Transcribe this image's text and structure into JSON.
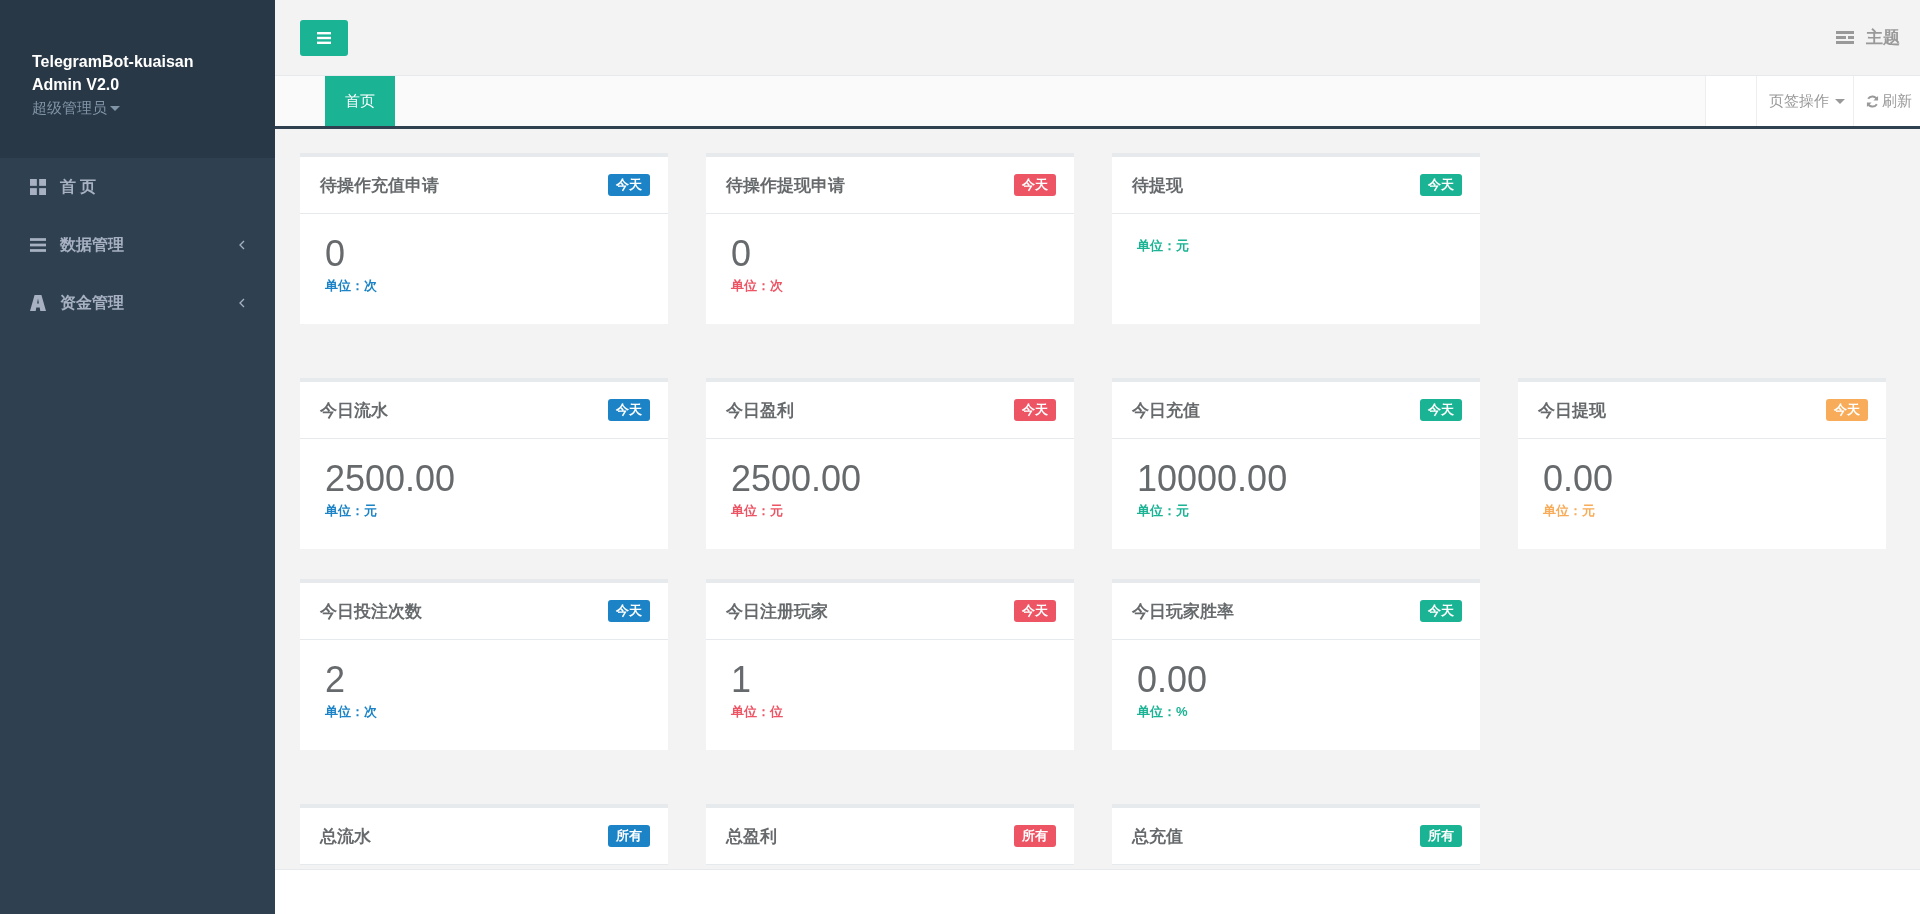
{
  "sidebar": {
    "brand": [
      "TelegramBot-kuaisan",
      "Admin V2.0"
    ],
    "role": "超级管理员",
    "items": [
      {
        "kind": "grid",
        "label": "首 页",
        "expandable": false
      },
      {
        "kind": "list",
        "label": "数据管理",
        "expandable": true
      },
      {
        "kind": "letter",
        "label": "资金管理",
        "expandable": true
      }
    ]
  },
  "topbar": {
    "theme": "主题"
  },
  "tabs": [
    {
      "label": "首页",
      "selected": true
    }
  ],
  "tab_actions": {
    "menu": "页签操作",
    "refresh": "刷新"
  },
  "groups": [
    {
      "cards": [
        {
          "title": "待操作充值申请",
          "badge": "今天",
          "color": "#1c84c6",
          "value": "0",
          "unit": "单位：次"
        },
        {
          "title": "待操作提现申请",
          "badge": "今天",
          "color": "#ed5565",
          "value": "0",
          "unit": "单位：次"
        },
        {
          "title": "待提现",
          "badge": "今天",
          "color": "#1ab394",
          "unit": "单位：元"
        }
      ]
    },
    {
      "cards": [
        {
          "title": "今日流水",
          "badge": "今天",
          "color": "#1c84c6",
          "value": "2500.00",
          "unit": "单位：元"
        },
        {
          "title": "今日盈利",
          "badge": "今天",
          "color": "#ed5565",
          "value": "2500.00",
          "unit": "单位：元"
        },
        {
          "title": "今日充值",
          "badge": "今天",
          "color": "#1ab394",
          "value": "10000.00",
          "unit": "单位：元"
        },
        {
          "title": "今日提现",
          "badge": "今天",
          "color": "#f8ac59",
          "value": "0.00",
          "unit": "单位：元"
        },
        {
          "title": "今日投注次数",
          "badge": "今天",
          "color": "#1c84c6",
          "value": "2",
          "unit": "单位：次"
        },
        {
          "title": "今日注册玩家",
          "badge": "今天",
          "color": "#ed5565",
          "value": "1",
          "unit": "单位：位"
        },
        {
          "title": "今日玩家胜率",
          "badge": "今天",
          "color": "#1ab394",
          "value": "0.00",
          "unit": "单位：%"
        }
      ]
    },
    {
      "cards": [
        {
          "title": "总流水",
          "badge": "所有",
          "color": "#1c84c6"
        },
        {
          "title": "总盈利",
          "badge": "所有",
          "color": "#ed5565"
        },
        {
          "title": "总充值",
          "badge": "所有",
          "color": "#1ab394"
        }
      ]
    }
  ]
}
